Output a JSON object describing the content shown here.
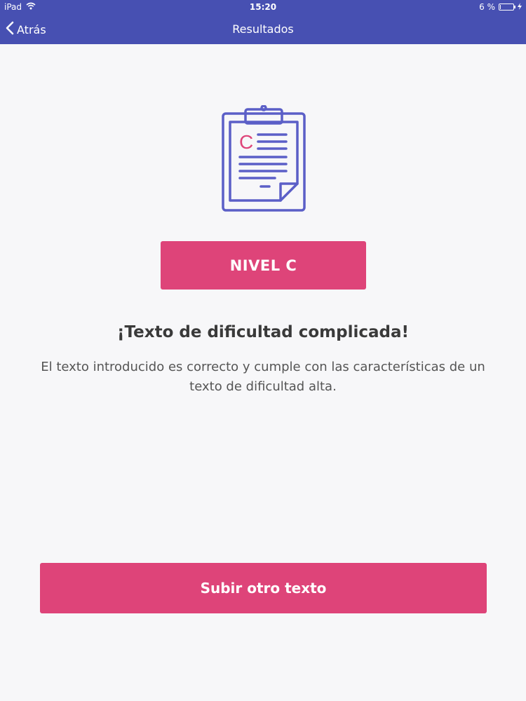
{
  "status_bar": {
    "device": "iPad",
    "time": "15:20",
    "battery": "6 %",
    "battery_level": 0.06
  },
  "nav": {
    "back_label": "Atrás",
    "title": "Resultados"
  },
  "illustration": {
    "icon": "clipboard-icon",
    "grade_letter": "C",
    "outline_color": "#5b5fc7",
    "letter_color": "#de4479"
  },
  "result": {
    "level_label": "NIVEL C",
    "title": "¡Texto de dificultad complicada!",
    "description": "El texto introducido es correcto y cumple con las características de un texto de dificultad alta."
  },
  "actions": {
    "upload_label": "Subir otro texto"
  },
  "colors": {
    "header": "#4750b2",
    "accent": "#de4479",
    "background": "#f7f7f9"
  }
}
